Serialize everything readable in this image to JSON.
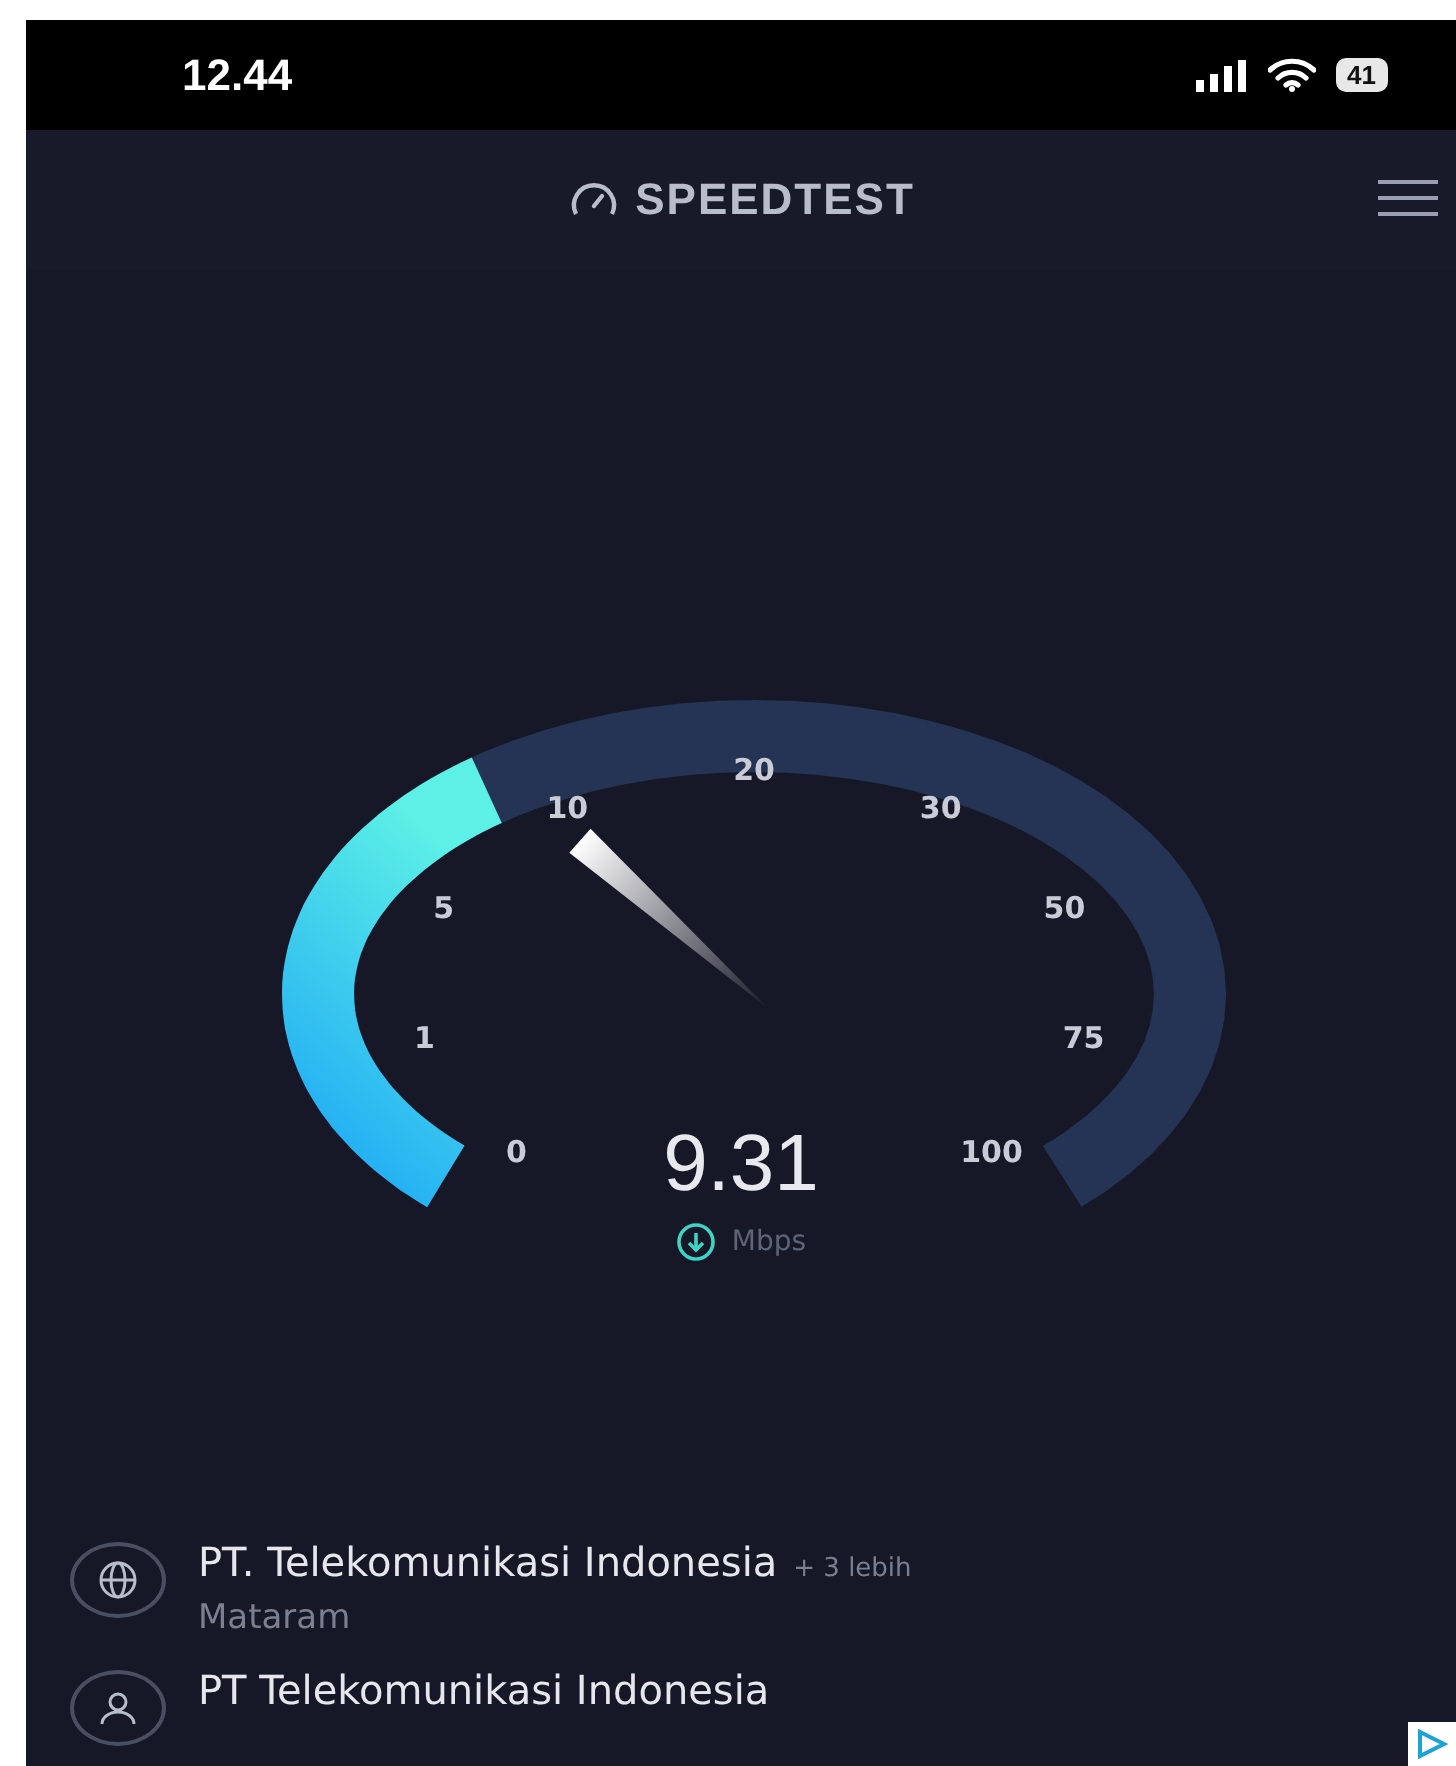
{
  "status_bar": {
    "time": "12.44",
    "battery": "41"
  },
  "header": {
    "title": "SPEEDTEST"
  },
  "gauge": {
    "ticks": [
      "0",
      "1",
      "5",
      "10",
      "20",
      "30",
      "50",
      "75",
      "100"
    ],
    "level": 0.36
  },
  "result": {
    "value": "9.31",
    "unit": "Mbps"
  },
  "servers": [
    {
      "kind": "isp",
      "name": "PT. Telekomunikasi Indonesia",
      "extra": "+ 3 lebih",
      "location": "Mataram"
    },
    {
      "kind": "user",
      "name": "PT Telekomunikasi Indonesia"
    }
  ]
}
